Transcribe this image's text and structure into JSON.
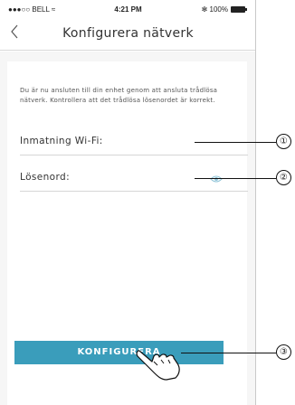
{
  "status_bar": {
    "carrier": "●●●○○ BELL ≈",
    "time": "4:21 PM",
    "battery": "✻ 100%"
  },
  "nav": {
    "title": "Konfigurera nätverk",
    "back_icon": "chevron-left-icon"
  },
  "info_text": "Du är nu ansluten till din enhet genom att ansluta trådlösa nätverk. Kontrollera att det trådlösa lösenordet är korrekt.",
  "fields": {
    "wifi_label": "Inmatning Wi-Fi:",
    "password_label": "Lösenord:",
    "password_icon": "eye-icon"
  },
  "button": {
    "label": "KONFIGURERA"
  },
  "callouts": [
    "①",
    "②",
    "③"
  ],
  "colors": {
    "accent": "#3a9dbb",
    "background": "#f6f6f6"
  }
}
